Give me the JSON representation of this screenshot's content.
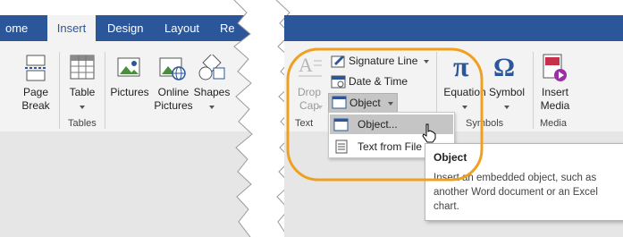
{
  "tabs": [
    "ome",
    "Insert",
    "Design",
    "Layout",
    "Re"
  ],
  "groups": {
    "pages": {
      "button": "Page\nBreak"
    },
    "tables": {
      "button": "Table",
      "label": "Tables"
    },
    "illustrations": {
      "pictures": "Pictures",
      "online": "Online\nPictures",
      "shapes": "Shapes"
    },
    "text": {
      "dropcap": "Drop\nCap",
      "label": "Text",
      "signature": "Signature Line",
      "datetime": "Date & Time",
      "object": "Object"
    },
    "symbols": {
      "equation": "Equation",
      "symbol": "Symbol",
      "label": "Symbols"
    },
    "media": {
      "button": "Insert\nMedia",
      "label": "Media"
    }
  },
  "dropdown": {
    "items": [
      "Object...",
      "Text from File"
    ]
  },
  "tooltip": {
    "title": "Object",
    "description": "Insert an embedded object, such as another Word document or an Excel chart."
  },
  "colors": {
    "tabbar": "#2b579a",
    "ribbon": "#f3f3f3",
    "highlight": "#f0a020"
  }
}
